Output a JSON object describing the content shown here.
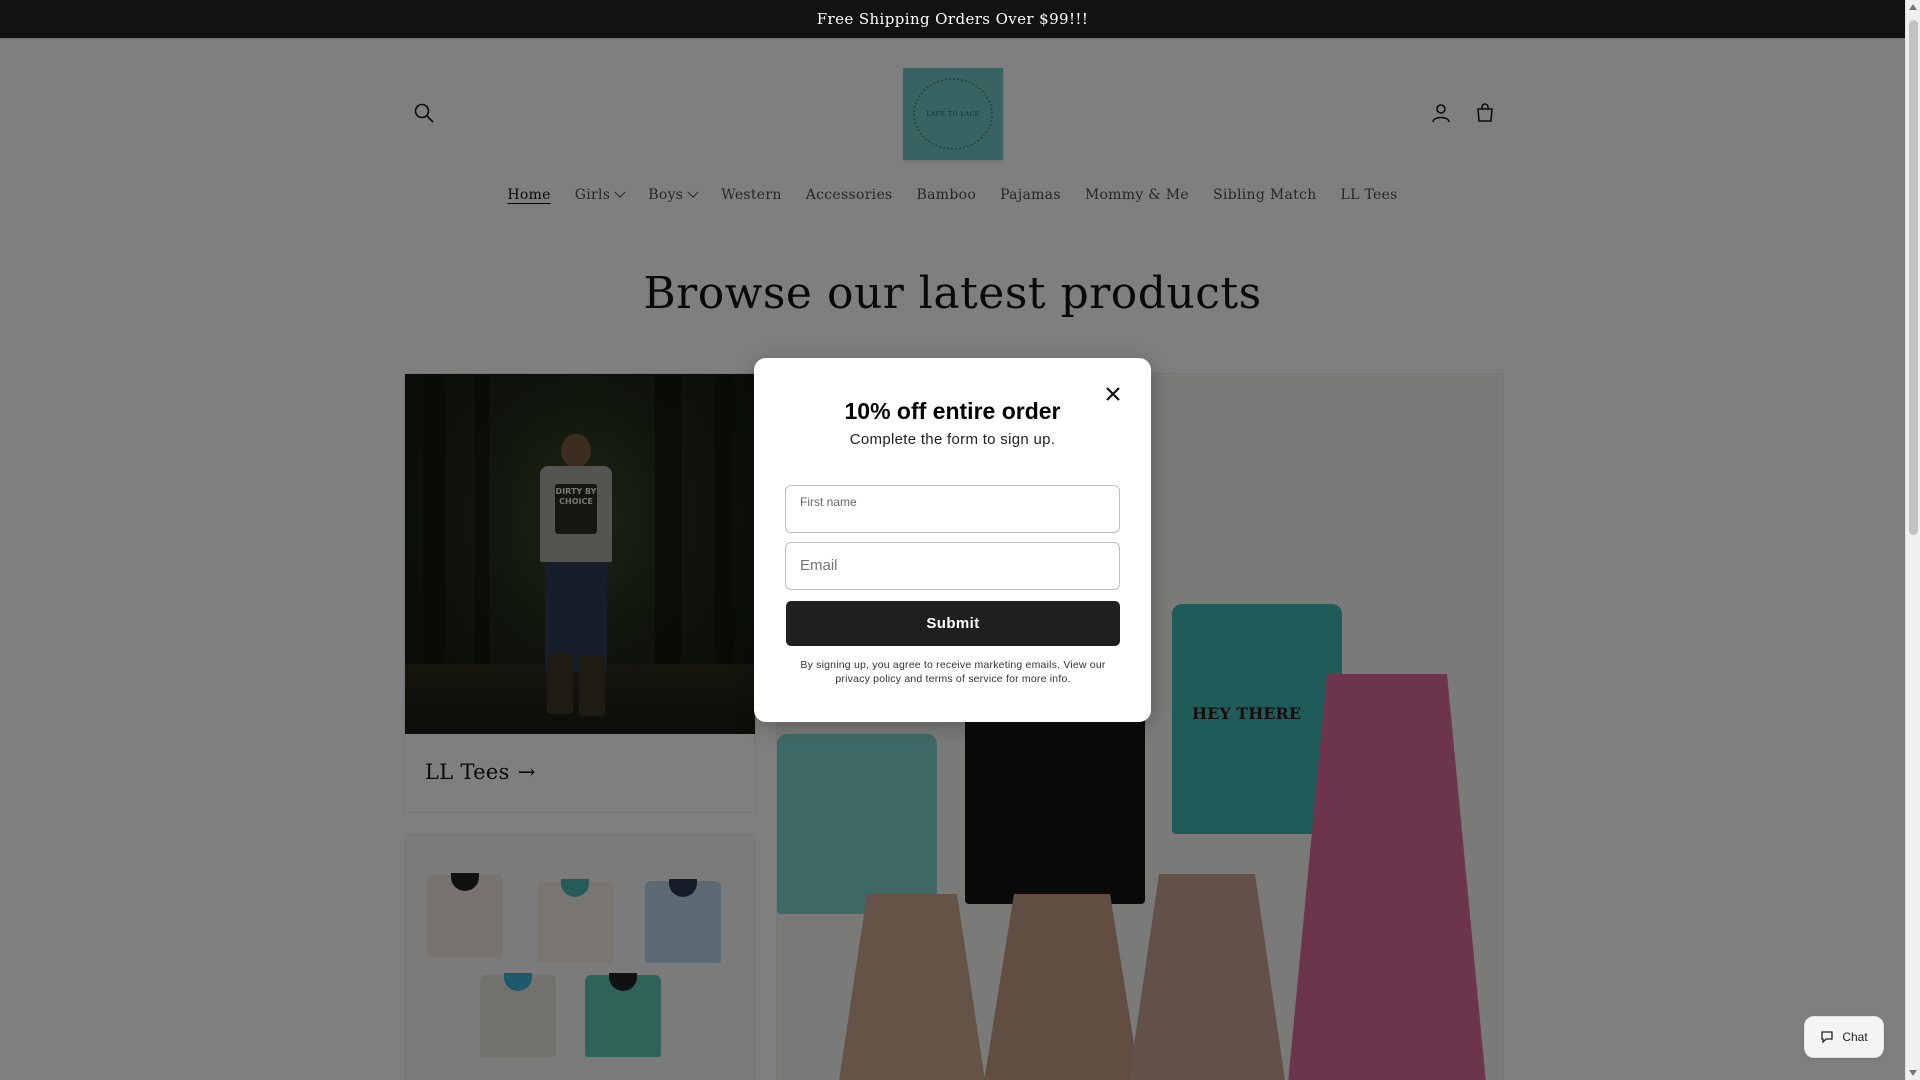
{
  "announcement": {
    "text": "Free Shipping Orders Over $99!!!"
  },
  "header": {
    "logo_text": "LACE TO LACE",
    "icons": {
      "search": "search-icon",
      "account": "account-icon",
      "cart": "cart-icon"
    }
  },
  "nav": {
    "items": [
      {
        "label": "Home",
        "active": true,
        "dropdown": false
      },
      {
        "label": "Girls",
        "active": false,
        "dropdown": true
      },
      {
        "label": "Boys",
        "active": false,
        "dropdown": true
      },
      {
        "label": "Western",
        "active": false,
        "dropdown": false
      },
      {
        "label": "Accessories",
        "active": false,
        "dropdown": false
      },
      {
        "label": "Bamboo",
        "active": false,
        "dropdown": false
      },
      {
        "label": "Pajamas",
        "active": false,
        "dropdown": false
      },
      {
        "label": "Mommy & Me",
        "active": false,
        "dropdown": false
      },
      {
        "label": "Sibling Match",
        "active": false,
        "dropdown": false
      },
      {
        "label": "LL Tees",
        "active": false,
        "dropdown": false
      }
    ]
  },
  "main": {
    "title": "Browse our latest products",
    "collections": [
      {
        "label": "LL Tees",
        "arrow": "→",
        "shirt_print": "DIRTY BY CHOICE"
      }
    ]
  },
  "modal": {
    "title": "10% off entire order",
    "subtitle": "Complete the form to sign up.",
    "first_name_label": "First name",
    "email_placeholder": "Email",
    "submit_label": "Submit",
    "disclaimer": "By signing up, you agree to receive marketing emails. View our privacy policy and terms of service for more info.",
    "outfit_print": "HEY THERE"
  },
  "chat": {
    "label": "Chat"
  },
  "colors": {
    "announcement_bg": "#121212",
    "logo_bg": "#6fc9c4",
    "submit_bg": "#1f1f1f"
  }
}
